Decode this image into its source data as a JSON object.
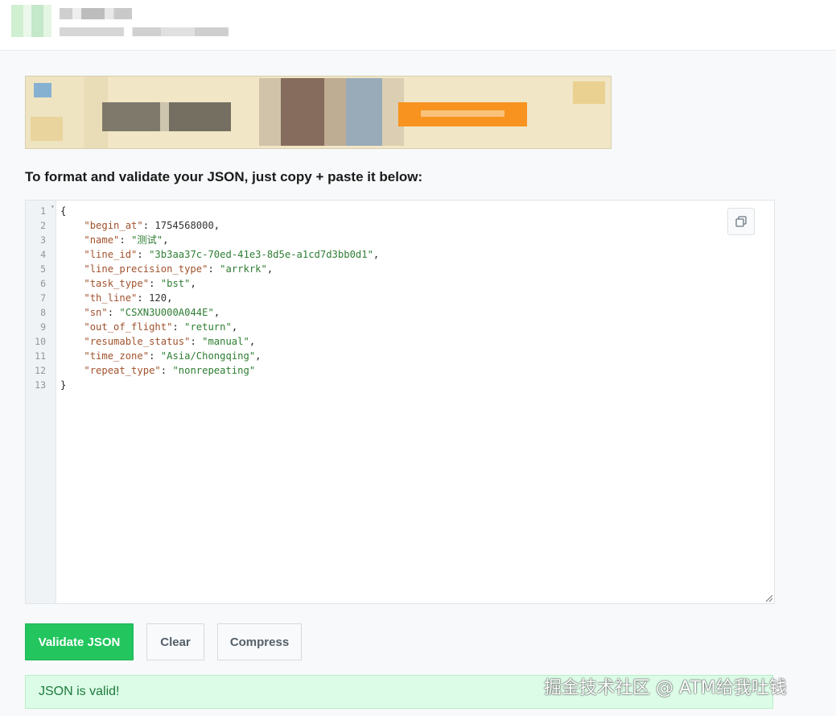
{
  "header": {
    "logo_icon": "site-logo-icon"
  },
  "instruction": "To format and validate your JSON, just copy + paste it below:",
  "editor": {
    "line_numbers": [
      "1",
      "2",
      "3",
      "4",
      "5",
      "6",
      "7",
      "8",
      "9",
      "10",
      "11",
      "12",
      "13"
    ],
    "open_brace": "{",
    "close_brace": "}",
    "entries": [
      {
        "key": "\"begin_at\"",
        "value": "1754568000",
        "type": "number"
      },
      {
        "key": "\"name\"",
        "value": "\"测试\"",
        "type": "string"
      },
      {
        "key": "\"line_id\"",
        "value": "\"3b3aa37c-70ed-41e3-8d5e-a1cd7d3bb0d1\"",
        "type": "string"
      },
      {
        "key": "\"line_precision_type\"",
        "value": "\"arrkrk\"",
        "type": "string"
      },
      {
        "key": "\"task_type\"",
        "value": "\"bst\"",
        "type": "string"
      },
      {
        "key": "\"th_line\"",
        "value": "120",
        "type": "number"
      },
      {
        "key": "\"sn\"",
        "value": "\"CSXN3U000A044E\"",
        "type": "string"
      },
      {
        "key": "\"out_of_flight\"",
        "value": "\"return\"",
        "type": "string"
      },
      {
        "key": "\"resumable_status\"",
        "value": "\"manual\"",
        "type": "string"
      },
      {
        "key": "\"time_zone\"",
        "value": "\"Asia/Chongqing\"",
        "type": "string"
      },
      {
        "key": "\"repeat_type\"",
        "value": "\"nonrepeating\"",
        "type": "string"
      }
    ],
    "copy_icon": "copy-icon"
  },
  "buttons": {
    "validate": "Validate JSON",
    "clear": "Clear",
    "compress": "Compress"
  },
  "status": {
    "message": "JSON is valid!"
  },
  "watermark": "掘金技术社区 @ ATM给我吐钱",
  "colors": {
    "accent_green": "#22c55e",
    "status_bg": "#dcfce7",
    "status_text": "#1d7a3c",
    "json_key": "#a0522d",
    "json_string": "#2e7d32"
  }
}
